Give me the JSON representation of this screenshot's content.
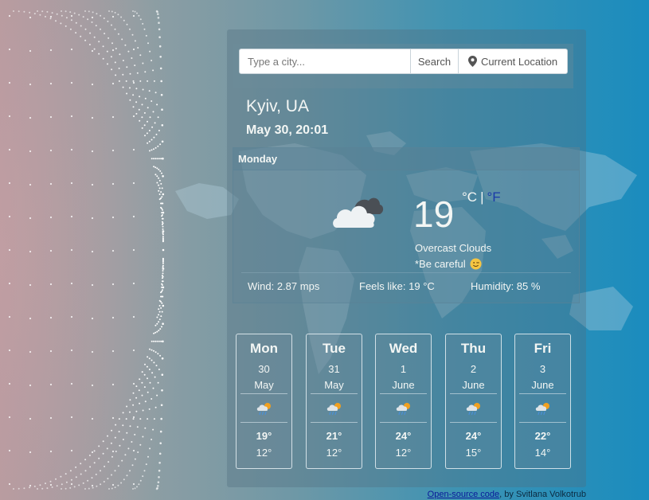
{
  "search": {
    "placeholder": "Type a city...",
    "search_label": "Search",
    "location_label": "Current Location",
    "location_icon": "map-marker-icon"
  },
  "current": {
    "city": "Kyiv, UA",
    "datetime": "May 30, 20:01",
    "day_label": "Monday",
    "icon": "overcast-clouds-icon",
    "temperature": "19",
    "unit_c": "°C",
    "unit_sep": "|",
    "unit_f": "°F",
    "description": "Overcast Clouds",
    "advice": "*Be careful",
    "advice_icon": "wink-emoji-icon",
    "wind": "Wind: 2.87 mps",
    "feels_like": "Feels like: 19 °C",
    "humidity": "Humidity: 85 %"
  },
  "forecast": [
    {
      "day": "Mon",
      "date": "30",
      "month": "May",
      "icon": "cloud-sun-rain-icon",
      "max": "19°",
      "min": "12°"
    },
    {
      "day": "Tue",
      "date": "31",
      "month": "May",
      "icon": "cloud-sun-rain-icon",
      "max": "21°",
      "min": "12°"
    },
    {
      "day": "Wed",
      "date": "1",
      "month": "June",
      "icon": "cloud-sun-rain-icon",
      "max": "24°",
      "min": "12°"
    },
    {
      "day": "Thu",
      "date": "2",
      "month": "June",
      "icon": "cloud-sun-rain-icon",
      "max": "24°",
      "min": "15°"
    },
    {
      "day": "Fri",
      "date": "3",
      "month": "June",
      "icon": "cloud-sun-rain-icon",
      "max": "22°",
      "min": "14°"
    }
  ],
  "footer": {
    "link_text": "Open-source code",
    "by_text": ", by Svitlana Volkotrub"
  },
  "colors": {
    "text_light": "#f3f6f4",
    "unit_f_link": "#1a3aa8",
    "footer_link": "#0a1a99",
    "background_right": "#1a8cbe"
  }
}
